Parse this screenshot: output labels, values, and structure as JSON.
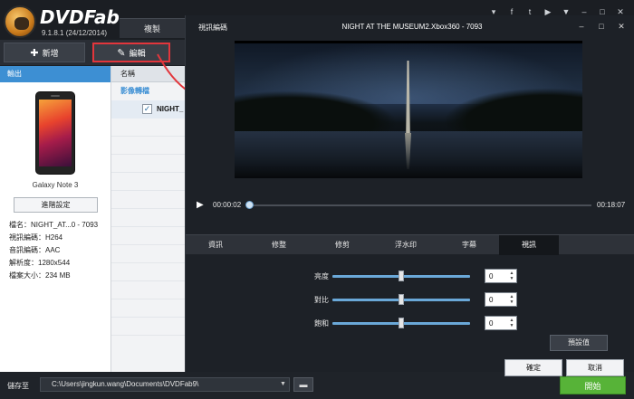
{
  "app": {
    "name": "DVDFab",
    "version": "9.1.8.1 (24/12/2014)",
    "main_tab": "複製",
    "window_controls": [
      "▾",
      "f",
      "t",
      "▶",
      "▼",
      "‒",
      "□",
      "✕"
    ]
  },
  "toolbar": {
    "new_label": "新增",
    "edit_label": "編輯"
  },
  "output_panel": {
    "header": "輸出",
    "device_name": "Galaxy Note 3",
    "advanced_label": "進階設定",
    "info": [
      "檔名：NIGHT_AT...0 - 7093",
      "視訊編碼：H264",
      "音訊編碼：AAC",
      "解析度：1280x544",
      "檔案大小：234 MB"
    ]
  },
  "list_panel": {
    "header": "名稱",
    "group_label": "影像轉檔",
    "item_label": "NIGHT_"
  },
  "bottom_bar": {
    "save_label": "儲存至",
    "save_path": "C:\\Users\\jingkun.wang\\Documents\\DVDFab9\\",
    "start_label": "開始"
  },
  "dialog": {
    "title": "視訊編碼",
    "video_title": "NIGHT  AT  THE  MUSEUM2.Xbox360 - 7093",
    "controls": [
      "‒",
      "□",
      "✕"
    ],
    "time_current": "00:00:02",
    "time_total": "00:18:07",
    "tabs": [
      "資訊",
      "修整",
      "修剪",
      "浮水印",
      "字幕",
      "視訊"
    ],
    "active_tab": "視訊",
    "sliders": [
      {
        "label": "亮度",
        "value": "0",
        "level": 0.5
      },
      {
        "label": "對比",
        "value": "0",
        "level": 0.5
      },
      {
        "label": "飽和",
        "value": "0",
        "level": 0.5
      }
    ],
    "default_label": "預設值",
    "ok_label": "確定",
    "cancel_label": "取消"
  },
  "colors": {
    "accent_blue": "#3d8fd3",
    "start_green": "#57b338",
    "highlight_red": "#e2363c"
  }
}
